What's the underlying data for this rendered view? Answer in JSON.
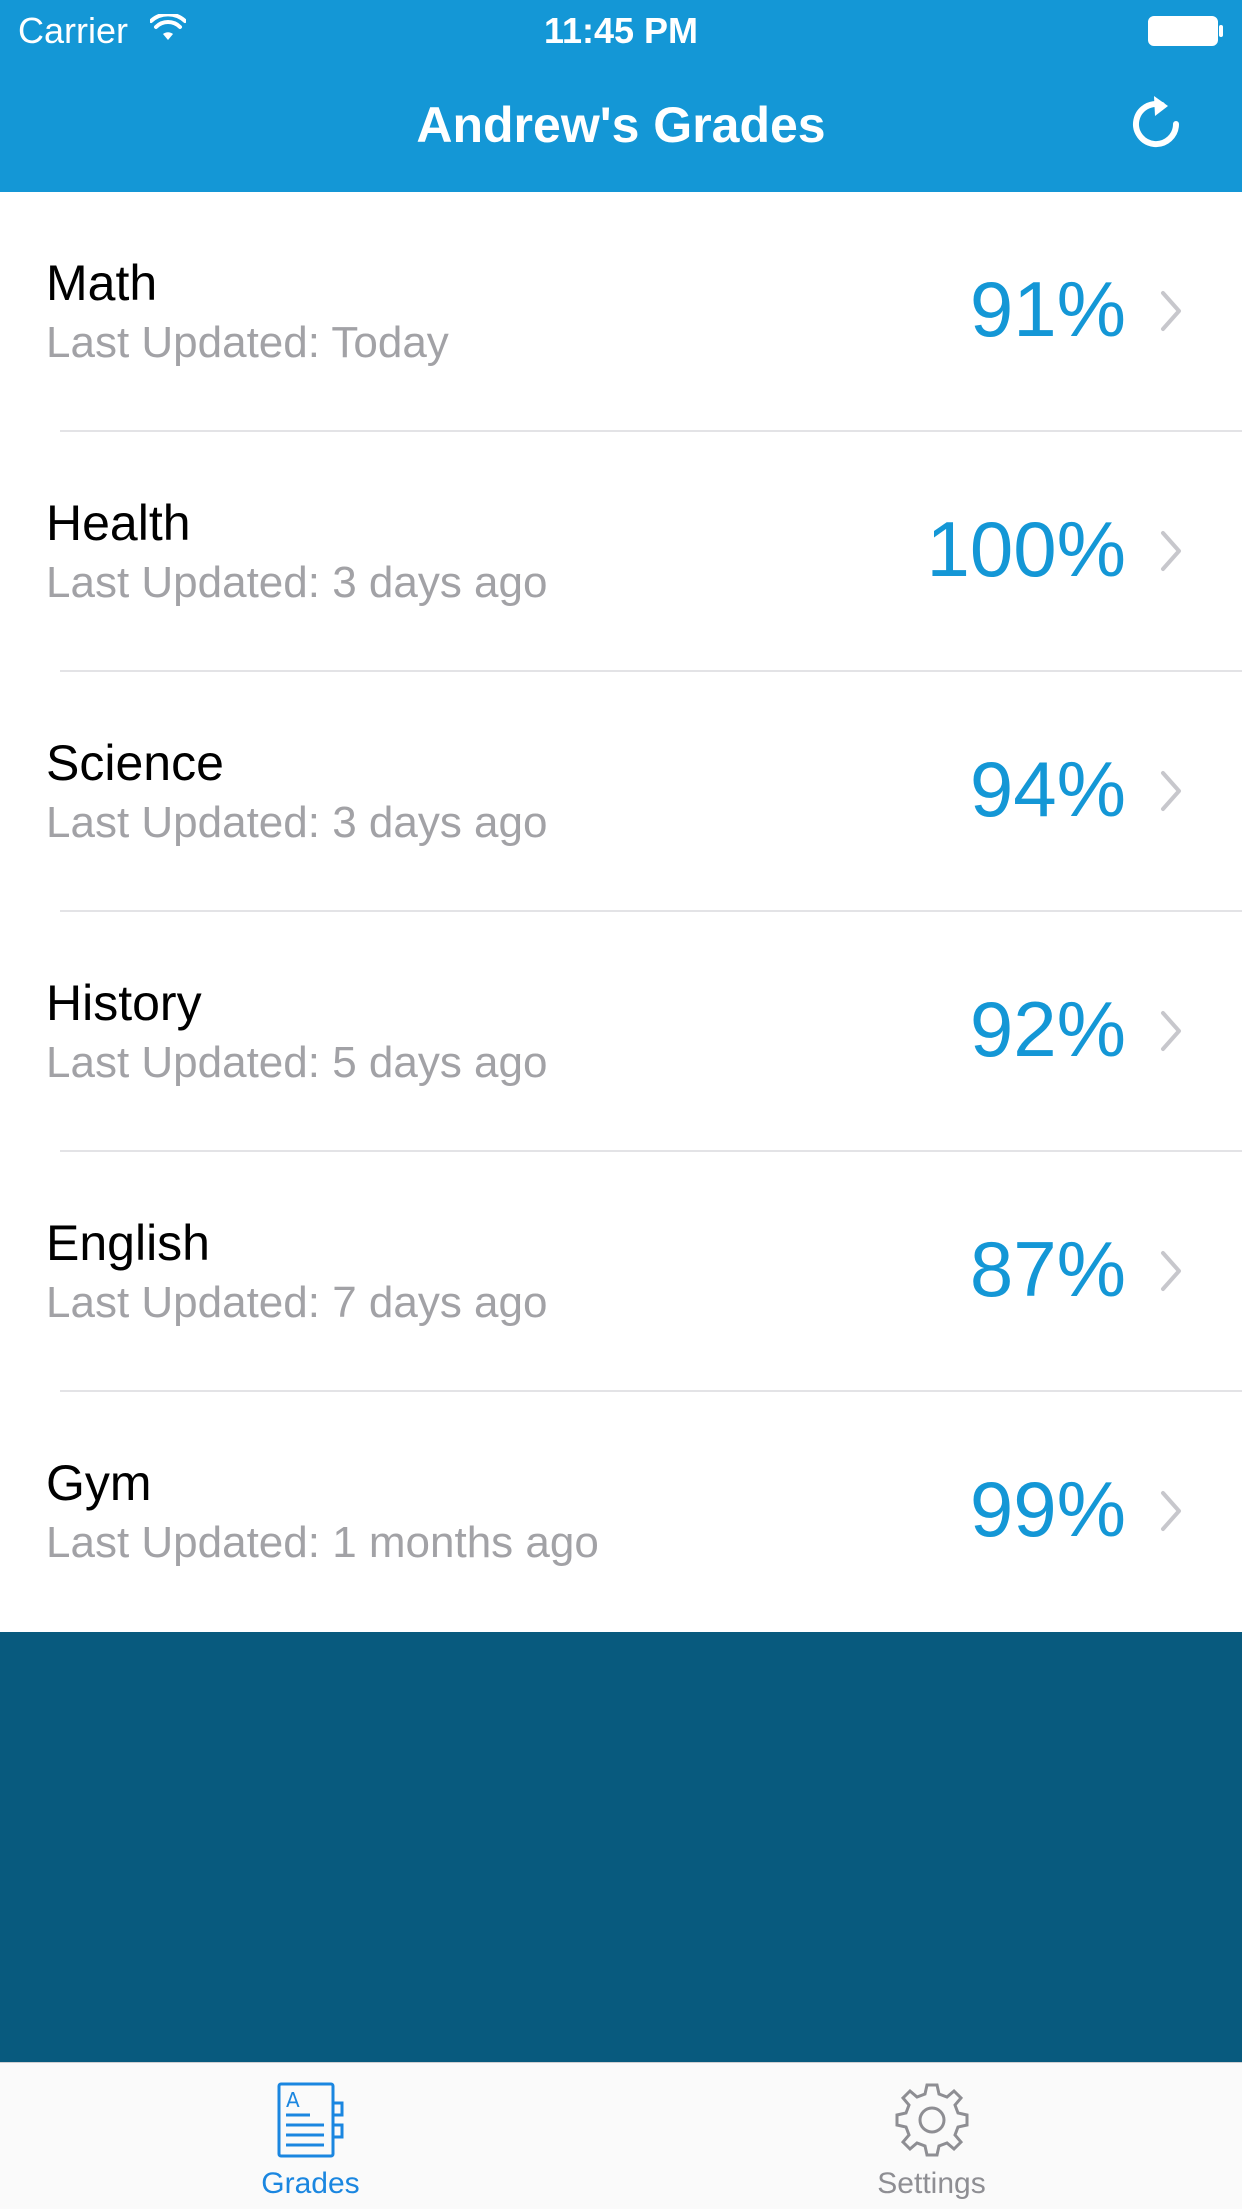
{
  "status_bar": {
    "carrier": "Carrier",
    "time": "11:45 PM"
  },
  "nav": {
    "title": "Andrew's Grades",
    "refresh_icon": "refresh-icon"
  },
  "grades": [
    {
      "subject": "Math",
      "updated": "Last Updated: Today",
      "grade": "91%"
    },
    {
      "subject": "Health",
      "updated": "Last Updated: 3 days ago",
      "grade": "100%"
    },
    {
      "subject": "Science",
      "updated": "Last Updated: 3 days ago",
      "grade": "94%"
    },
    {
      "subject": "History",
      "updated": "Last Updated: 5 days ago",
      "grade": "92%"
    },
    {
      "subject": "English",
      "updated": "Last Updated: 7 days ago",
      "grade": "87%"
    },
    {
      "subject": "Gym",
      "updated": "Last Updated: 1 months ago",
      "grade": "99%"
    }
  ],
  "tabs": [
    {
      "label": "Grades",
      "icon": "grades-document-icon",
      "selected": true
    },
    {
      "label": "Settings",
      "icon": "gear-icon",
      "selected": false
    }
  ],
  "colors": {
    "accent": "#1497d6",
    "dark_area": "#085a7e",
    "tab_selected": "#1a86e0",
    "tab_unselected": "#8e8e93",
    "subtitle": "#a2a2a6"
  }
}
